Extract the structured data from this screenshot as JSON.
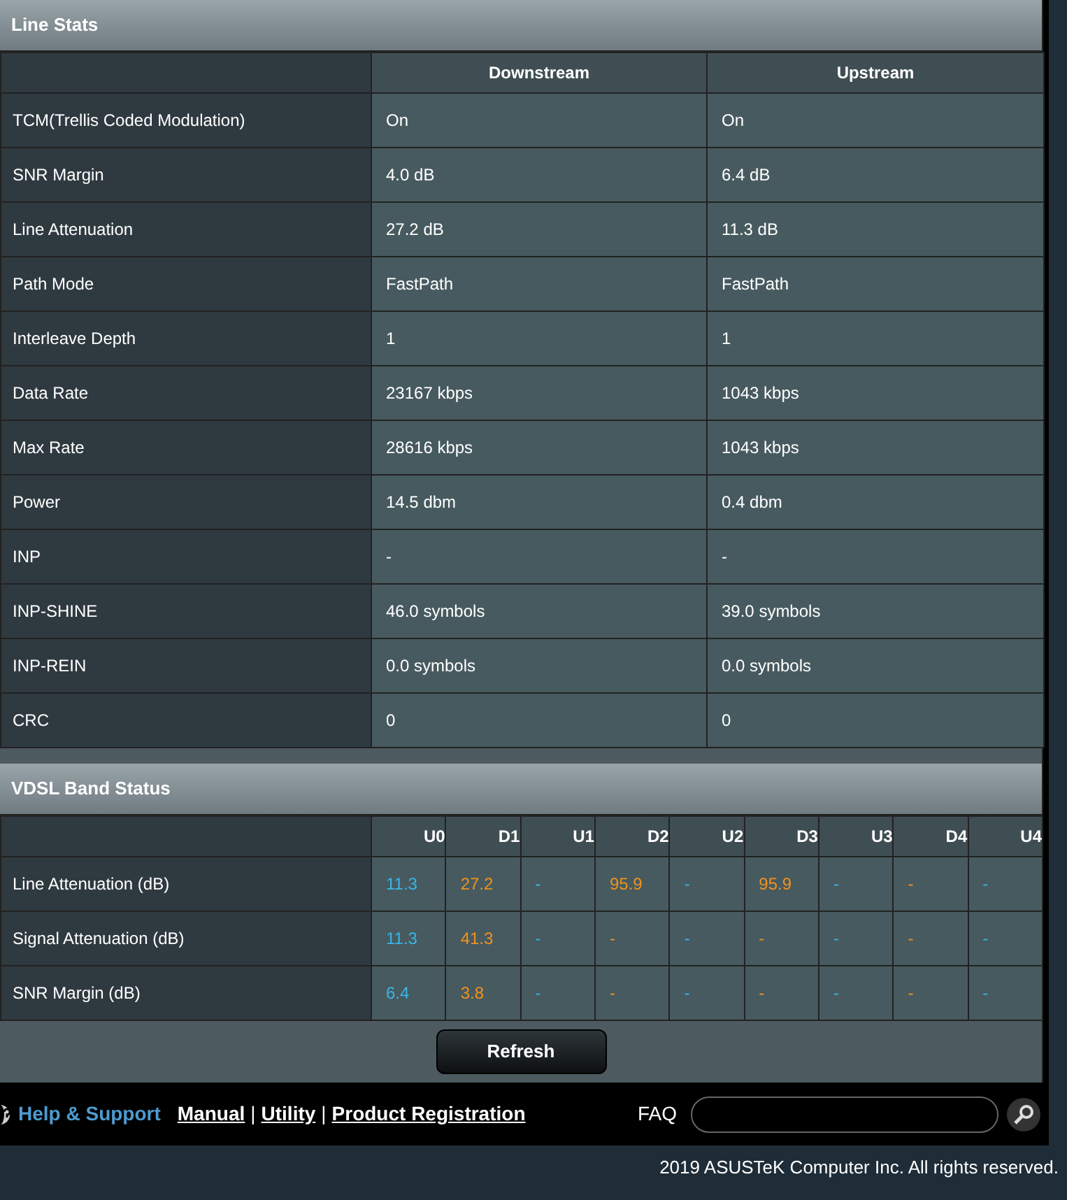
{
  "line_stats": {
    "title": "Line Stats",
    "columns": [
      "Downstream",
      "Upstream"
    ],
    "rows": [
      {
        "label": "TCM(Trellis Coded Modulation)",
        "values": [
          "On",
          "On"
        ]
      },
      {
        "label": "SNR Margin",
        "values": [
          "4.0 dB",
          "6.4 dB"
        ]
      },
      {
        "label": "Line Attenuation",
        "values": [
          "27.2 dB",
          "11.3 dB"
        ]
      },
      {
        "label": "Path Mode",
        "values": [
          "FastPath",
          "FastPath"
        ]
      },
      {
        "label": "Interleave Depth",
        "values": [
          "1",
          "1"
        ]
      },
      {
        "label": "Data Rate",
        "values": [
          "23167 kbps",
          "1043 kbps"
        ]
      },
      {
        "label": "Max Rate",
        "values": [
          "28616 kbps",
          "1043 kbps"
        ]
      },
      {
        "label": "Power",
        "values": [
          "14.5 dbm",
          "0.4 dbm"
        ]
      },
      {
        "label": "INP",
        "values": [
          "-",
          "-"
        ]
      },
      {
        "label": "INP-SHINE",
        "values": [
          "46.0 symbols",
          "39.0 symbols"
        ]
      },
      {
        "label": "INP-REIN",
        "values": [
          "0.0 symbols",
          "0.0 symbols"
        ]
      },
      {
        "label": "CRC",
        "values": [
          "0",
          "0"
        ]
      }
    ]
  },
  "band_status": {
    "title": "VDSL Band Status",
    "columns": [
      {
        "label": "U0",
        "color": "#38b6e8"
      },
      {
        "label": "D1",
        "color": "#f0921e"
      },
      {
        "label": "U1",
        "color": "#38b6e8"
      },
      {
        "label": "D2",
        "color": "#f0921e"
      },
      {
        "label": "U2",
        "color": "#38b6e8"
      },
      {
        "label": "D3",
        "color": "#f0921e"
      },
      {
        "label": "U3",
        "color": "#38b6e8"
      },
      {
        "label": "D4",
        "color": "#f0921e"
      },
      {
        "label": "U4",
        "color": "#38b6e8"
      }
    ],
    "rows": [
      {
        "label": "Line Attenuation (dB)",
        "values": [
          "11.3",
          "27.2",
          "-",
          "95.9",
          "-",
          "95.9",
          "-",
          "-",
          "-"
        ]
      },
      {
        "label": "Signal Attenuation (dB)",
        "values": [
          "11.3",
          "41.3",
          "-",
          "-",
          "-",
          "-",
          "-",
          "-",
          "-"
        ]
      },
      {
        "label": "SNR Margin (dB)",
        "values": [
          "6.4",
          "3.8",
          "-",
          "-",
          "-",
          "-",
          "-",
          "-",
          "-"
        ]
      }
    ]
  },
  "refresh_button": "Refresh",
  "footer": {
    "help": "Help & Support",
    "links": [
      "Manual",
      "Utility",
      "Product Registration"
    ],
    "separators": [
      "|",
      "|"
    ],
    "faq_label": "FAQ"
  },
  "copyright": "2019 ASUSTeK Computer Inc. All rights reserved."
}
